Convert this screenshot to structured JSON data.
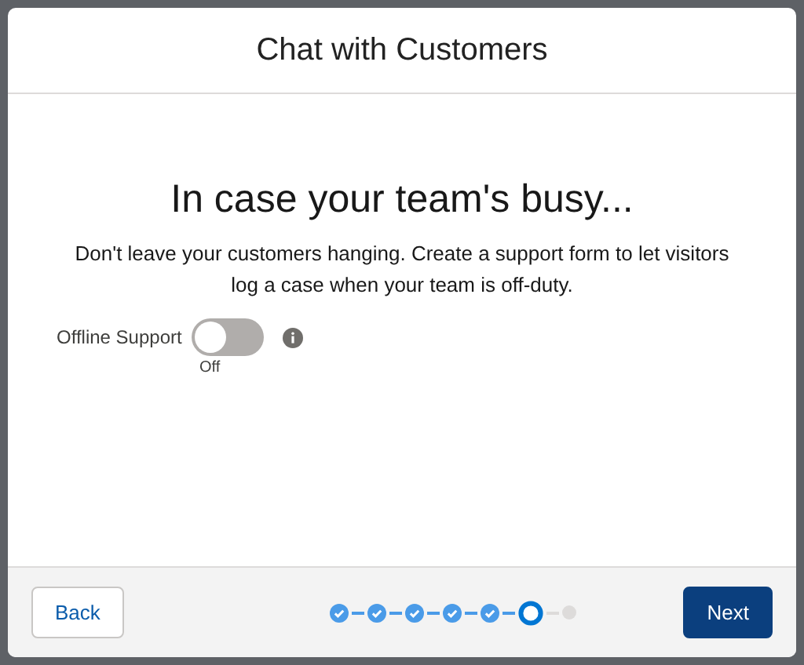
{
  "modal": {
    "title": "Chat with Customers"
  },
  "heading": "In case your team's busy...",
  "description": "Don't leave your customers hanging. Create a support form to let visitors log a case when your team is off-duty.",
  "toggle": {
    "label": "Offline Support",
    "on": false,
    "state_text": "Off"
  },
  "steps": [
    {
      "completed": true,
      "selected": false
    },
    {
      "completed": true,
      "selected": false
    },
    {
      "completed": true,
      "selected": false
    },
    {
      "completed": true,
      "selected": false
    },
    {
      "completed": true,
      "selected": false
    },
    {
      "completed": false,
      "selected": true
    },
    {
      "completed": false,
      "selected": false
    }
  ],
  "buttons": {
    "back": "Back",
    "next": "Next"
  }
}
